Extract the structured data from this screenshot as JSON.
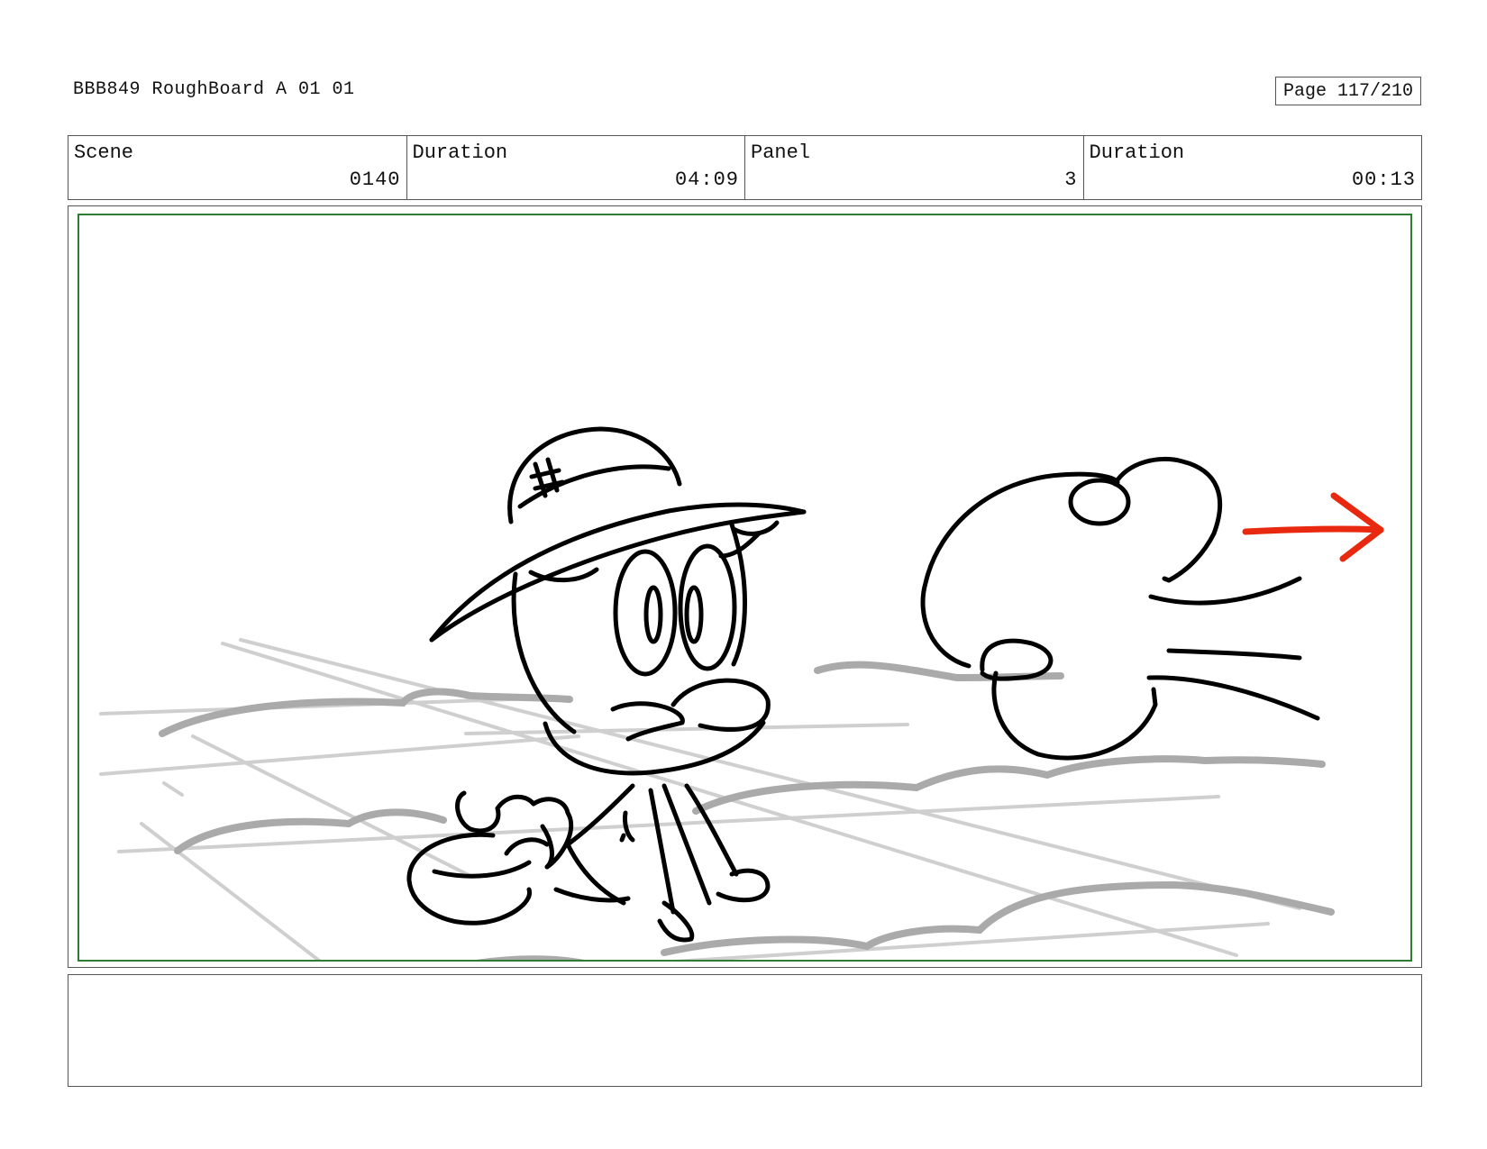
{
  "header": {
    "title": "BBB849 RoughBoard A 01 01",
    "page": "Page 117/210"
  },
  "info": {
    "scene_label": "Scene",
    "scene_value": "0140",
    "scene_duration_label": "Duration",
    "scene_duration_value": "04:09",
    "panel_label": "Panel",
    "panel_value": "3",
    "panel_duration_label": "Duration",
    "panel_duration_value": "00:13"
  },
  "notes": {
    "text": ""
  },
  "colors": {
    "safe_frame": "#2e7d32",
    "motion_arrow": "#e8290f",
    "ink": "#000000",
    "background_sketch": "#bdbdbd"
  },
  "icons": {
    "motion_arrow": "arrow-right-icon"
  }
}
